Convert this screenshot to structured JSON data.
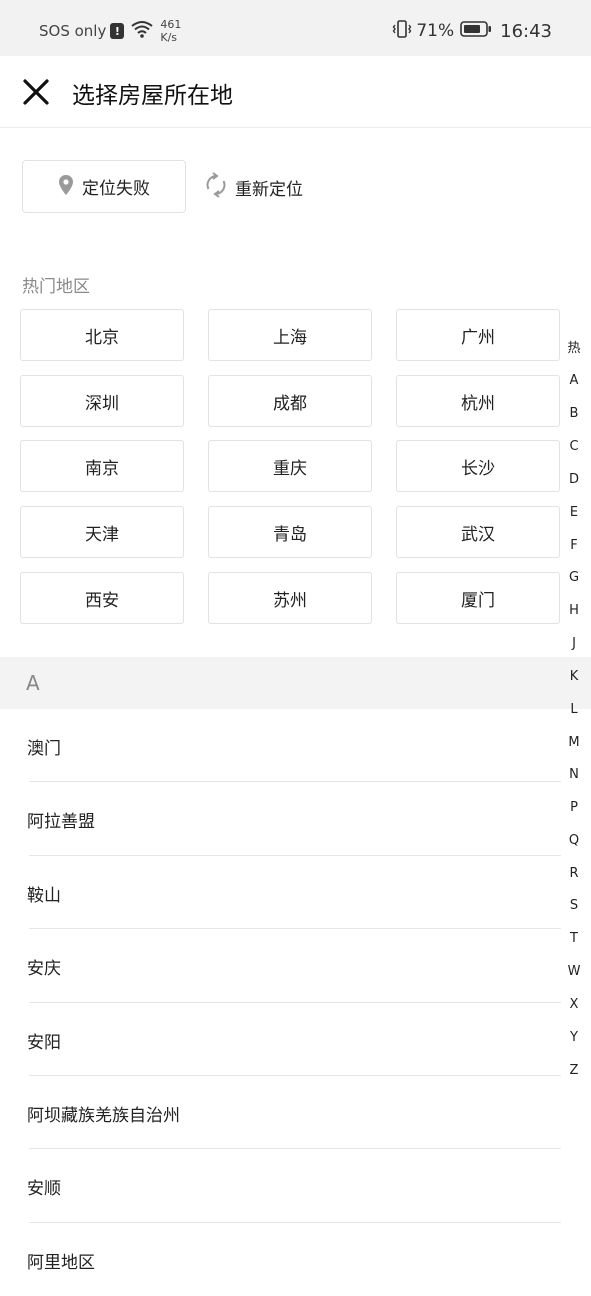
{
  "status_bar": {
    "carrier": "SOS only",
    "net_speed_value": "461",
    "net_speed_unit": "K/s",
    "battery_percent": "71%",
    "time": "16:43"
  },
  "header": {
    "title": "选择房屋所在地",
    "close_icon": "close-icon"
  },
  "location": {
    "status_label": "定位失败",
    "relocate_label": "重新定位",
    "pin_icon": "location-pin-icon",
    "refresh_icon": "refresh-icon"
  },
  "hot": {
    "title": "热门地区",
    "cities": [
      "北京",
      "上海",
      "广州",
      "深圳",
      "成都",
      "杭州",
      "南京",
      "重庆",
      "长沙",
      "天津",
      "青岛",
      "武汉",
      "西安",
      "苏州",
      "厦门"
    ]
  },
  "section": {
    "letter": "A",
    "cities": [
      "澳门",
      "阿拉善盟",
      "鞍山",
      "安庆",
      "安阳",
      "阿坝藏族羌族自治州",
      "安顺",
      "阿里地区"
    ]
  },
  "index_bar": [
    "热",
    "A",
    "B",
    "C",
    "D",
    "E",
    "F",
    "G",
    "H",
    "J",
    "K",
    "L",
    "M",
    "N",
    "P",
    "Q",
    "R",
    "S",
    "T",
    "W",
    "X",
    "Y",
    "Z"
  ],
  "colors": {
    "text": "#222222",
    "muted": "#8a8a8a",
    "border": "#e2e2e2",
    "section_bg": "#f3f3f3"
  }
}
